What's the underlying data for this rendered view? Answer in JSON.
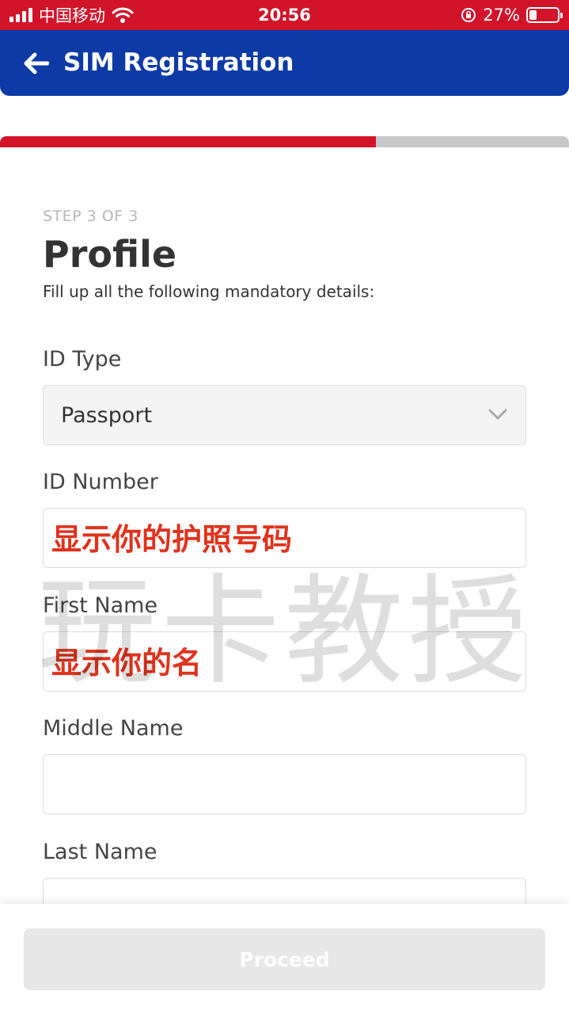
{
  "status_bar": {
    "carrier": "中国移动",
    "time": "20:56",
    "battery_percent": "27%",
    "battery_level": 0.27
  },
  "header": {
    "title": "SIM Registration",
    "back_icon": "arrow-left-icon"
  },
  "progress": {
    "value": 0.66
  },
  "form": {
    "step": "STEP 3 OF 3",
    "title": "Profile",
    "subtitle": "Fill up all the following mandatory details:",
    "fields": [
      {
        "label": "ID Type",
        "value": "Passport"
      },
      {
        "label": "ID Number",
        "value": "显示你的护照号码"
      },
      {
        "label": "First Name",
        "value": "显示你的名"
      },
      {
        "label": "Middle Name",
        "value": ""
      },
      {
        "label": "Last Name",
        "value": ""
      }
    ]
  },
  "watermark": "玩卡教授",
  "footer": {
    "proceed_label": "Proceed"
  },
  "colors": {
    "brand_red": "#d2142a",
    "brand_blue": "#0d3aa5",
    "note_red": "#e0321c"
  }
}
